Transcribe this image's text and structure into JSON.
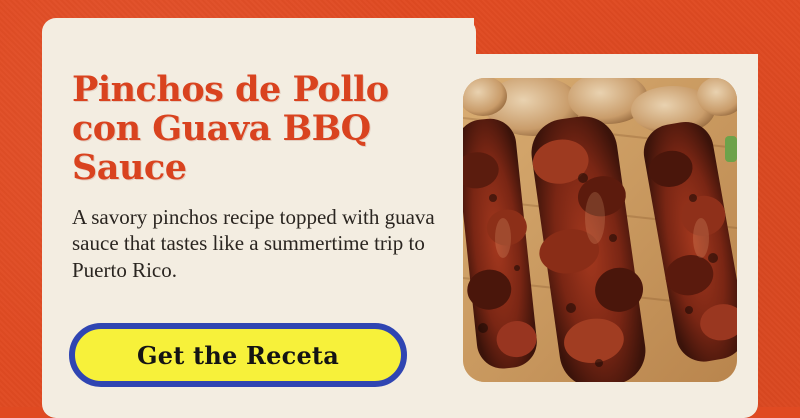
{
  "recipe": {
    "title": "Pinchos de Pollo con Guava BBQ Sauce",
    "description": "A savory pinchos recipe topped with guava sauce that tastes like a summertime trip to Puerto Rico.",
    "cta_label": "Get the Receta"
  },
  "image": {
    "icon": "grilled-chicken-skewers-photo"
  },
  "colors": {
    "background": "#e04a22",
    "card": "#f3ede1",
    "title": "#d9431f",
    "cta_fill": "#f7f13a",
    "cta_border": "#2f45b2"
  }
}
